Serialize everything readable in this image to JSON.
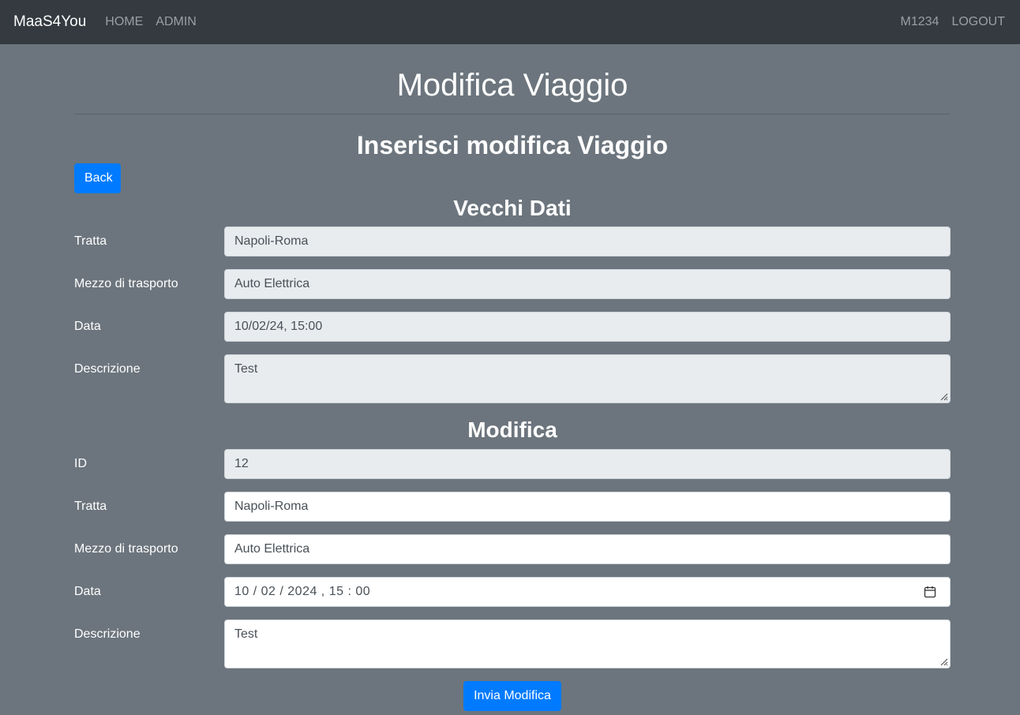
{
  "navbar": {
    "brand": "MaaS4You",
    "links": [
      "HOME",
      "ADMIN"
    ],
    "user": "M1234",
    "logout": "LOGOUT"
  },
  "page": {
    "title": "Modifica Viaggio",
    "subtitle": "Inserisci modifica Viaggio",
    "back_label": "Back"
  },
  "old_data": {
    "section_title": "Vecchi Dati",
    "tratta_label": "Tratta",
    "tratta_value": "Napoli-Roma",
    "mezzo_label": "Mezzo di trasporto",
    "mezzo_value": "Auto Elettrica",
    "data_label": "Data",
    "data_value": "10/02/24, 15:00",
    "descrizione_label": "Descrizione",
    "descrizione_value": "Test"
  },
  "edit": {
    "section_title": "Modifica",
    "id_label": "ID",
    "id_value": "12",
    "tratta_label": "Tratta",
    "tratta_value": "Napoli-Roma",
    "mezzo_label": "Mezzo di trasporto",
    "mezzo_value": "Auto Elettrica",
    "data_label": "Data",
    "data_value": "10 / 02 / 2024 ,  15 : 00",
    "descrizione_label": "Descrizione",
    "descrizione_value": "Test",
    "submit_label": "Invia Modifica"
  },
  "colors": {
    "navbar_bg": "#343a40",
    "page_bg": "#6c757d",
    "primary": "#007bff",
    "readonly_bg": "#e9ecef"
  }
}
